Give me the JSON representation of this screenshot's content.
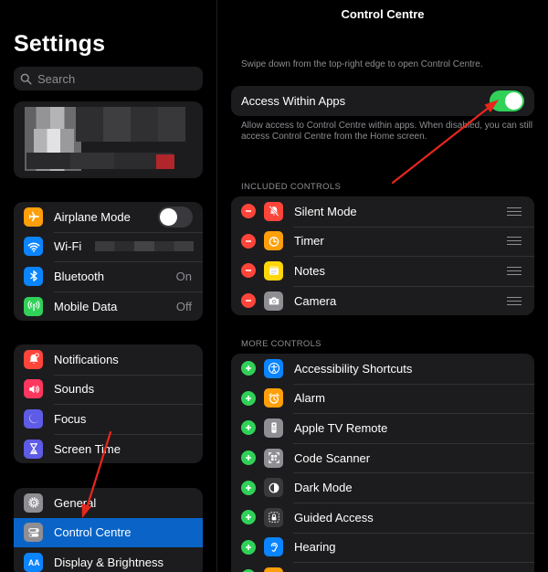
{
  "sidebar": {
    "title": "Settings",
    "search_placeholder": "Search",
    "group1": [
      {
        "name": "airplane-mode",
        "label": "Airplane Mode",
        "icon": "airplane-icon",
        "color": "#ff9f0a",
        "toggle": false
      },
      {
        "name": "wifi",
        "label": "Wi-Fi",
        "icon": "wifi-icon",
        "color": "#0a84ff",
        "value": ""
      },
      {
        "name": "bluetooth",
        "label": "Bluetooth",
        "icon": "bluetooth-icon",
        "color": "#0a84ff",
        "value": "On"
      },
      {
        "name": "mobile-data",
        "label": "Mobile Data",
        "icon": "antenna-icon",
        "color": "#30d158",
        "value": "Off"
      }
    ],
    "group2": [
      {
        "name": "notifications",
        "label": "Notifications",
        "icon": "bell-icon",
        "color": "#ff453a"
      },
      {
        "name": "sounds",
        "label": "Sounds",
        "icon": "speaker-icon",
        "color": "#ff375f"
      },
      {
        "name": "focus",
        "label": "Focus",
        "icon": "moon-icon",
        "color": "#5e5ce6"
      },
      {
        "name": "screen-time",
        "label": "Screen Time",
        "icon": "hourglass-icon",
        "color": "#5e5ce6"
      }
    ],
    "group3": [
      {
        "name": "general",
        "label": "General",
        "icon": "gear-icon",
        "color": "#8e8e93"
      },
      {
        "name": "control-centre",
        "label": "Control Centre",
        "icon": "switches-icon",
        "color": "#8e8e93",
        "selected": true
      },
      {
        "name": "display-brightness",
        "label": "Display & Brightness",
        "icon": "aa-icon",
        "color": "#0a84ff"
      }
    ]
  },
  "main": {
    "title": "Control Centre",
    "hint": "Swipe down from the top-right edge to open Control Centre.",
    "access_within_apps": {
      "label": "Access Within Apps",
      "on": true
    },
    "access_desc": "Allow access to Control Centre within apps. When disabled, you can still access Control Centre from the Home screen.",
    "included_header": "INCLUDED CONTROLS",
    "included": [
      {
        "name": "silent-mode",
        "label": "Silent Mode",
        "icon": "bell-slash-icon",
        "color": "#ff453a"
      },
      {
        "name": "timer",
        "label": "Timer",
        "icon": "timer-icon",
        "color": "#ff9f0a"
      },
      {
        "name": "notes",
        "label": "Notes",
        "icon": "notes-icon",
        "color": "#ffd60a"
      },
      {
        "name": "camera",
        "label": "Camera",
        "icon": "camera-icon",
        "color": "#8e8e93"
      }
    ],
    "more_header": "MORE CONTROLS",
    "more": [
      {
        "name": "accessibility-shortcuts",
        "label": "Accessibility Shortcuts",
        "icon": "accessibility-icon",
        "color": "#0a84ff"
      },
      {
        "name": "alarm",
        "label": "Alarm",
        "icon": "alarm-icon",
        "color": "#ff9f0a"
      },
      {
        "name": "apple-tv-remote",
        "label": "Apple TV Remote",
        "icon": "remote-icon",
        "color": "#8e8e93"
      },
      {
        "name": "code-scanner",
        "label": "Code Scanner",
        "icon": "qr-icon",
        "color": "#8e8e93"
      },
      {
        "name": "dark-mode",
        "label": "Dark Mode",
        "icon": "dark-mode-icon",
        "color": "#3a3a3c"
      },
      {
        "name": "guided-access",
        "label": "Guided Access",
        "icon": "lock-icon",
        "color": "#3a3a3c"
      },
      {
        "name": "hearing",
        "label": "Hearing",
        "icon": "ear-icon",
        "color": "#0a84ff"
      },
      {
        "name": "partial",
        "label": "",
        "icon": "orange-icon",
        "color": "#ff9f0a"
      }
    ]
  }
}
